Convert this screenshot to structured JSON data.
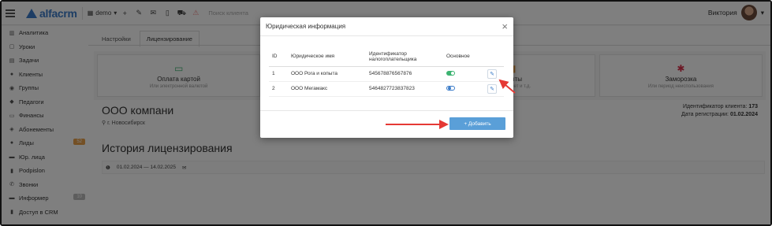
{
  "app": {
    "logo": "alfacrm",
    "branch": "demo",
    "search_placeholder": "Поиск клиента",
    "user_name": "Виктория"
  },
  "sidebar": {
    "items": [
      {
        "label": "Аналитика",
        "icon": "chart-icon"
      },
      {
        "label": "Уроки",
        "icon": "calendar-icon"
      },
      {
        "label": "Задачи",
        "icon": "tasks-icon"
      },
      {
        "label": "Клиенты",
        "icon": "user-icon"
      },
      {
        "label": "Группы",
        "icon": "users-icon"
      },
      {
        "label": "Педагоги",
        "icon": "graduation-cap-icon"
      },
      {
        "label": "Финансы",
        "icon": "money-icon"
      },
      {
        "label": "Абонементы",
        "icon": "tag-icon"
      },
      {
        "label": "Лиды",
        "icon": "user-plus-icon",
        "badge": "52"
      },
      {
        "label": "Юр. лица",
        "icon": "building-icon"
      },
      {
        "label": "Podpislon",
        "icon": "document-icon"
      },
      {
        "label": "Звонки",
        "icon": "phone-icon"
      },
      {
        "label": "Информер",
        "icon": "envelope-icon",
        "badge": "10"
      },
      {
        "label": "Доступ в CRM",
        "icon": "lock-icon"
      }
    ]
  },
  "main": {
    "tabs": [
      "Настройки",
      "Лицензирование"
    ],
    "cards": [
      {
        "title": "Оплата картой",
        "subtitle": "Или электронной валютой"
      },
      {
        "title": "",
        "subtitle": ""
      },
      {
        "title": "...ыты",
        "subtitle": "ИНН, счет и т.д."
      },
      {
        "title": "Заморозка",
        "subtitle": "Или период неиспользования"
      }
    ],
    "company": "ООО компани",
    "city": "г. Новосибирск",
    "client_id_label": "Идентификатор клиента:",
    "client_id": "173",
    "reg_date_label": "Дата регистрации:",
    "reg_date": "01.02.2024",
    "history_title": "История лицензирования",
    "period": "01.02.2024 — 14.02.2025"
  },
  "modal": {
    "title": "Юридическая информация",
    "columns": [
      "ID",
      "Юридическое имя",
      "Идентификатор налогоплательщика",
      "Основное"
    ],
    "rows": [
      {
        "id": "1",
        "name": "ООО Рога и копыта",
        "inn": "545678876567876",
        "main": true
      },
      {
        "id": "2",
        "name": "ООО Мегамакс",
        "inn": "5464827723837823",
        "main": false
      }
    ],
    "add_label": "+ Добавить"
  },
  "colors": {
    "accent": "#3a7bc8",
    "toggle_on": "#3cb371",
    "add_button": "#5a9fd8",
    "arrow": "#e53935"
  }
}
